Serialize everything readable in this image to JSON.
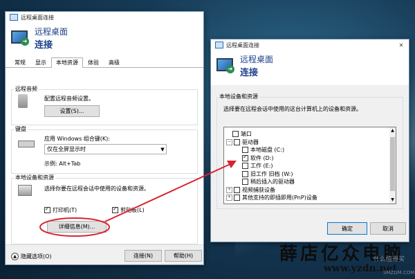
{
  "left_window": {
    "title": "远程桌面连接",
    "header_line1": "远程桌面",
    "header_line2": "连接",
    "tabs": [
      "常规",
      "显示",
      "本地资源",
      "体验",
      "高级"
    ],
    "active_tab": "本地资源",
    "audio": {
      "group": "远程音频",
      "desc": "配置远程音频设置。",
      "button": "设置(S)..."
    },
    "keyboard": {
      "group": "键盘",
      "desc": "应用 Windows 组合键(K):",
      "selected": "仅在全屏显示时",
      "example": "示例: Alt+Tab"
    },
    "devices": {
      "group": "本地设备和资源",
      "desc": "选择你要在远程会话中使用的设备和资源。",
      "printer": "打印机(T)",
      "clipboard": "剪贴板(L)",
      "details_button": "详细信息(M)..."
    },
    "hide_options": "隐藏选项(O)",
    "connect_button": "连接(N)",
    "help_button": "帮助(H)"
  },
  "right_window": {
    "title": "远程桌面连接",
    "header_line1": "远程桌面",
    "header_line2": "连接",
    "group": "本地设备和资源",
    "desc": "选择要在远程会话中使用的这台计算机上的设备和资源。",
    "tree": [
      {
        "label": "端口",
        "level": 0,
        "expander": "",
        "checked": false
      },
      {
        "label": "驱动器",
        "level": 0,
        "expander": "−",
        "checked": false
      },
      {
        "label": "本地磁盘 (C:)",
        "level": 1,
        "expander": "",
        "checked": false
      },
      {
        "label": "软件 (D:)",
        "level": 1,
        "expander": "",
        "checked": true
      },
      {
        "label": "工作 (E:)",
        "level": 1,
        "expander": "",
        "checked": false
      },
      {
        "label": "旧工作 旧档 (W:)",
        "level": 1,
        "expander": "",
        "checked": false
      },
      {
        "label": "稍后插入的驱动器",
        "level": 1,
        "expander": "",
        "checked": false
      },
      {
        "label": "视频捕获设备",
        "level": 0,
        "expander": "+",
        "checked": false
      },
      {
        "label": "其他支持的即插即用(PnP)设备",
        "level": 0,
        "expander": "+",
        "checked": false
      }
    ],
    "ok_button": "确定",
    "cancel_button": "取消"
  },
  "watermark": {
    "cn": "薛店亿众电脑",
    "url": "www.yzdn.net",
    "faint_top": "什么值得买",
    "faint_bottom": "SMZDM.COM"
  },
  "colors": {
    "accent": "#0078d7",
    "annotation": "#d9232e",
    "header_text": "#1b3f8a"
  }
}
